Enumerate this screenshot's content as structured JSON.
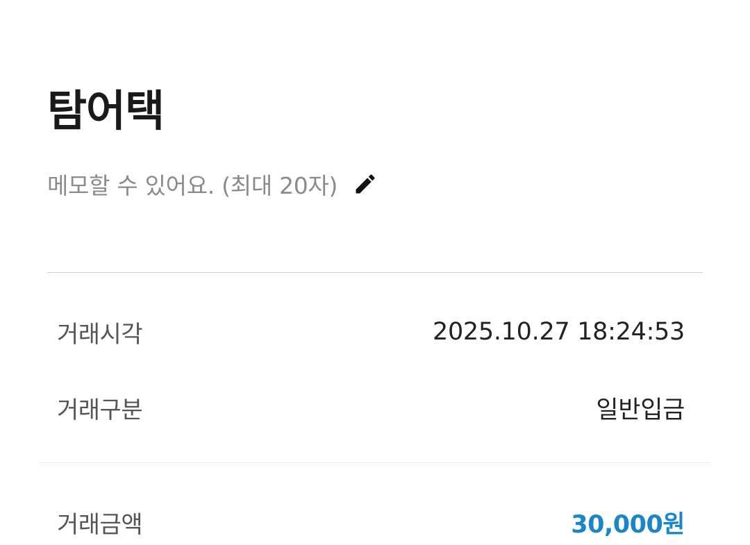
{
  "header": {
    "title": "탐어택",
    "memo_placeholder": "메모할 수 있어요. (최대 20자)",
    "memo_icon": "pencil-icon"
  },
  "details": {
    "time_label": "거래시각",
    "time_value": "2025.10.27 18:24:53",
    "type_label": "거래구분",
    "type_value": "일반입금",
    "amount_label": "거래금액",
    "amount_value": "30,000원"
  },
  "colors": {
    "amount": "#1a86c9",
    "title": "#1a1a1a",
    "memo": "#8a8a8a"
  }
}
